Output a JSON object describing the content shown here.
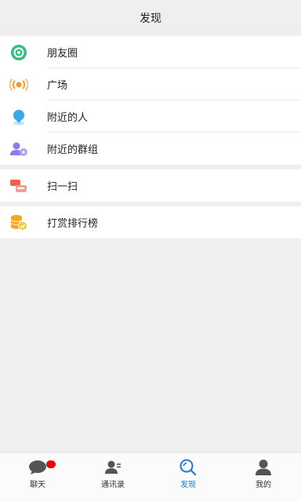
{
  "header": {
    "title": "发现"
  },
  "groups": [
    {
      "items": [
        {
          "label": "朋友圈",
          "icon": "moments-icon"
        },
        {
          "label": "广场",
          "icon": "broadcast-icon"
        },
        {
          "label": "附近的人",
          "icon": "location-pin-icon"
        },
        {
          "label": "附近的群组",
          "icon": "group-icon"
        }
      ]
    },
    {
      "items": [
        {
          "label": "扫一扫",
          "icon": "scan-icon"
        }
      ]
    },
    {
      "items": [
        {
          "label": "打赏排行榜",
          "icon": "coins-icon"
        }
      ]
    }
  ],
  "tabbar": {
    "active": "发现",
    "tabs": [
      {
        "label": "聊天",
        "icon": "chat-bubble-icon",
        "has_badge": true
      },
      {
        "label": "通讯录",
        "icon": "contacts-icon"
      },
      {
        "label": "发现",
        "icon": "discover-search-icon"
      },
      {
        "label": "我的",
        "icon": "profile-icon"
      }
    ]
  },
  "colors": {
    "accent": "#1a7bd6",
    "badge": "#ee0000",
    "moments": "#2ec27e",
    "broadcast": "#f39a2a",
    "location": "#3aa7e8",
    "group": "#8f7be8",
    "scan": "#f2614a",
    "coins": "#f5a623"
  }
}
